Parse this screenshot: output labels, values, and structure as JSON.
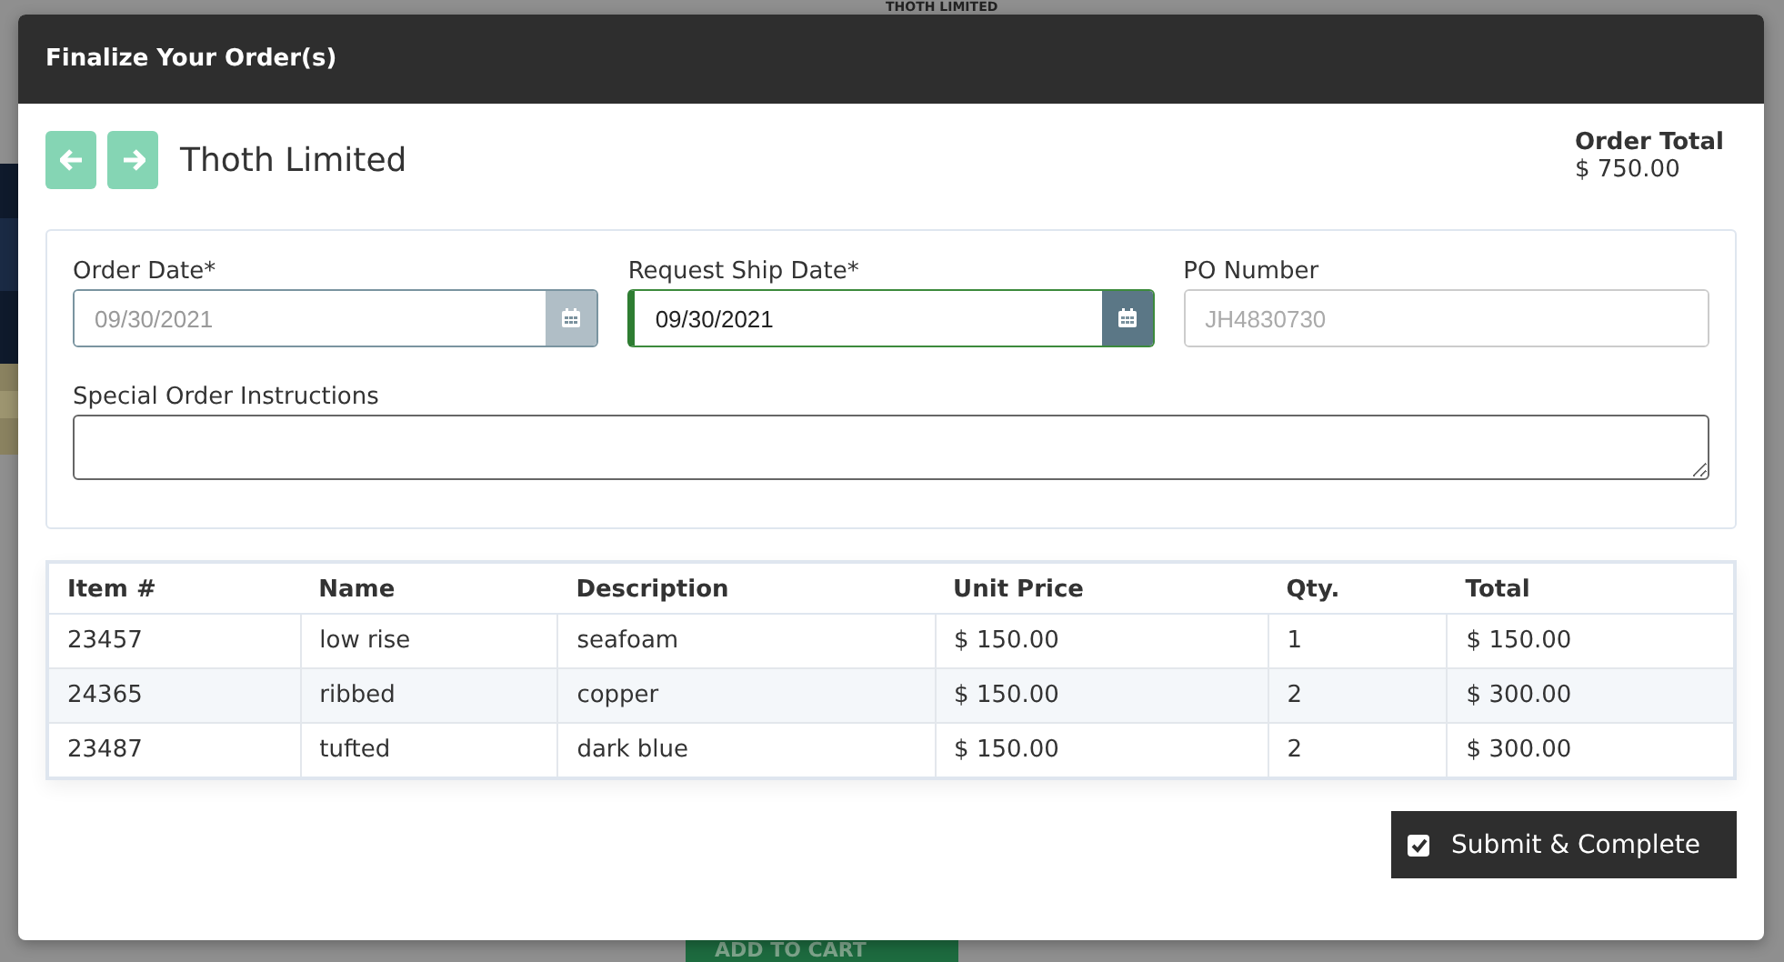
{
  "background": {
    "heading": "THOTH LIMITED",
    "cart_button": "ADD TO CART"
  },
  "dialog": {
    "title": "Finalize Your Order(s)",
    "customer": "Thoth Limited",
    "order_total": {
      "label": "Order Total",
      "value": "$ 750.00"
    },
    "fields": [
      {
        "label": "Order Date*",
        "value": "09/30/2021",
        "kind": "date",
        "disabled": true,
        "focused": false
      },
      {
        "label": "Request Ship Date*",
        "value": "09/30/2021",
        "kind": "date",
        "disabled": false,
        "focused": true
      },
      {
        "label": "PO Number",
        "placeholder": "JH4830730",
        "kind": "text",
        "disabled": false,
        "focused": false
      }
    ],
    "instructions": {
      "label": "Special Order Instructions"
    },
    "table": {
      "columns": [
        "Item #",
        "Name",
        "Description",
        "Unit Price",
        "Qty.",
        "Total"
      ],
      "rows": [
        [
          "23457",
          "low rise",
          "seafoam",
          "$ 150.00",
          "1",
          "$ 150.00"
        ],
        [
          "24365",
          "ribbed",
          "copper",
          "$ 150.00",
          "2",
          "$ 300.00"
        ],
        [
          "23487",
          "tufted",
          "dark blue",
          "$ 150.00",
          "2",
          "$ 300.00"
        ]
      ]
    },
    "submit": {
      "label": "Submit & Complete",
      "checked": true
    }
  }
}
